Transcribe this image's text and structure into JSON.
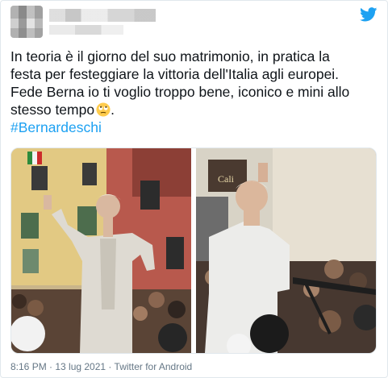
{
  "tweet": {
    "text_line1": "In teoria è il giorno del suo matrimonio, in pratica la",
    "text_line2": "festa per festeggiare la vittoria dell'Italia agli europei.",
    "text_line3": "Fede Berna io ti voglio troppo bene, iconico e mini allo",
    "text_line4": "stesso tempo",
    "text_line4_end": ".",
    "emoji": "rolling-eyes-emoji",
    "hashtag": "#Bernardeschi",
    "timestamp": "8:16 PM · 13 lug 2021 · Twitter for Android",
    "photo_left_sign": "",
    "photo_right_sign": "Cali"
  },
  "icons": {
    "brand": "twitter-bird-icon"
  },
  "colors": {
    "link": "#1da1f2",
    "meta": "#657786",
    "brand": "#1da1f2"
  }
}
